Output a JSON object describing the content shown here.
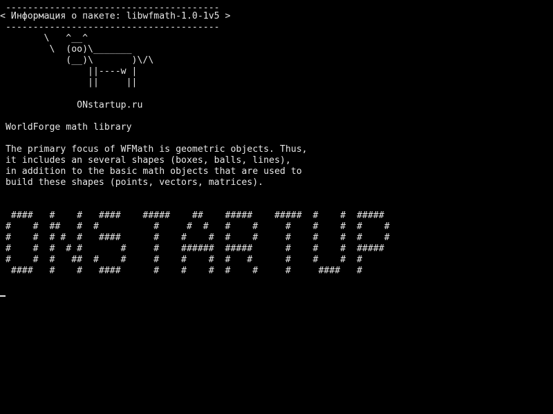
{
  "terminal": {
    "lines": [
      " ---------------------------------------",
      "< Информация о пакете: libwfmath-1.0-1v5 >",
      " ---------------------------------------",
      "        \\   ^__^",
      "         \\  (oo)\\_______",
      "            (__)\\       )\\/\\",
      "                ||----w |",
      "                ||     ||",
      "",
      "              ONstartup.ru",
      "",
      " WorldForge math library",
      "",
      " The primary focus of WFMath is geometric objects. Thus,",
      " it includes an several shapes (boxes, balls, lines),",
      " in addition to the basic math objects that are used to",
      " build these shapes (points, vectors, matrices).",
      "",
      "",
      "  ####   #    #   ####    #####    ##    #####    #####  #    #  #####",
      " #    #  ##   #  #          #     #  #   #    #     #    #    #  #    #",
      " #    #  # #  #   ####      #    #    #  #    #     #    #    #  #    #",
      " #    #  #  # #       #     #    ######  #####      #    #    #  #####",
      " #    #  #   ##  #    #     #    #    #  #   #      #    #    #  #",
      "  ####   #    #   ####      #    #    #  #    #     #     ####   #"
    ]
  },
  "colors": {
    "background": "#000000",
    "foreground": "#e6e6e6"
  }
}
